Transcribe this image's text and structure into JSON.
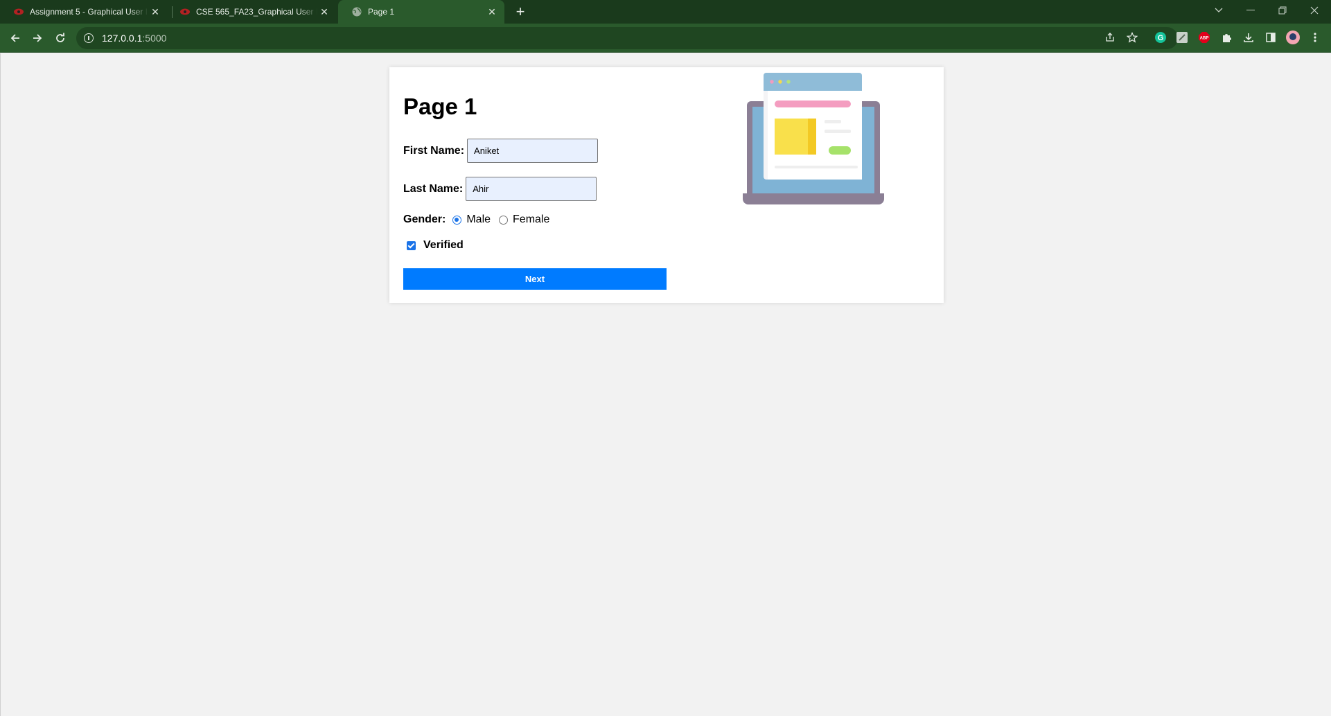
{
  "browser": {
    "tabs": [
      {
        "title": "Assignment 5 - Graphical User Interfaces",
        "active": false
      },
      {
        "title": "CSE 565_FA23_Graphical User Interfaces",
        "active": false
      },
      {
        "title": "Page 1",
        "active": true
      }
    ],
    "new_tab_symbol": "+",
    "close_symbol": "✕",
    "address": {
      "host": "127.0.0.1",
      "port": ":5000"
    },
    "extensions": [
      "share-icon",
      "bookmark-star-icon",
      "grammarly-icon",
      "zoom-icon",
      "adblock-plus-icon",
      "extensions-puzzle-icon",
      "download-icon",
      "side-panel-icon",
      "profile-avatar-icon",
      "menu-kebab-icon"
    ],
    "adblock_label": "ABP"
  },
  "page": {
    "title": "Page 1",
    "first_name": {
      "label": "First Name:",
      "value": "Aniket"
    },
    "last_name": {
      "label": "Last Name:",
      "value": "Ahir"
    },
    "gender": {
      "label": "Gender:",
      "options": [
        {
          "label": "Male",
          "checked": true
        },
        {
          "label": "Female",
          "checked": false
        }
      ]
    },
    "verified": {
      "label": "Verified",
      "checked": true
    },
    "next_button": "Next"
  },
  "colors": {
    "tabstrip": "#1a3a1c",
    "toolbar": "#2a5a2c",
    "button": "#007bff",
    "input_autofill": "#e8f0fe"
  }
}
